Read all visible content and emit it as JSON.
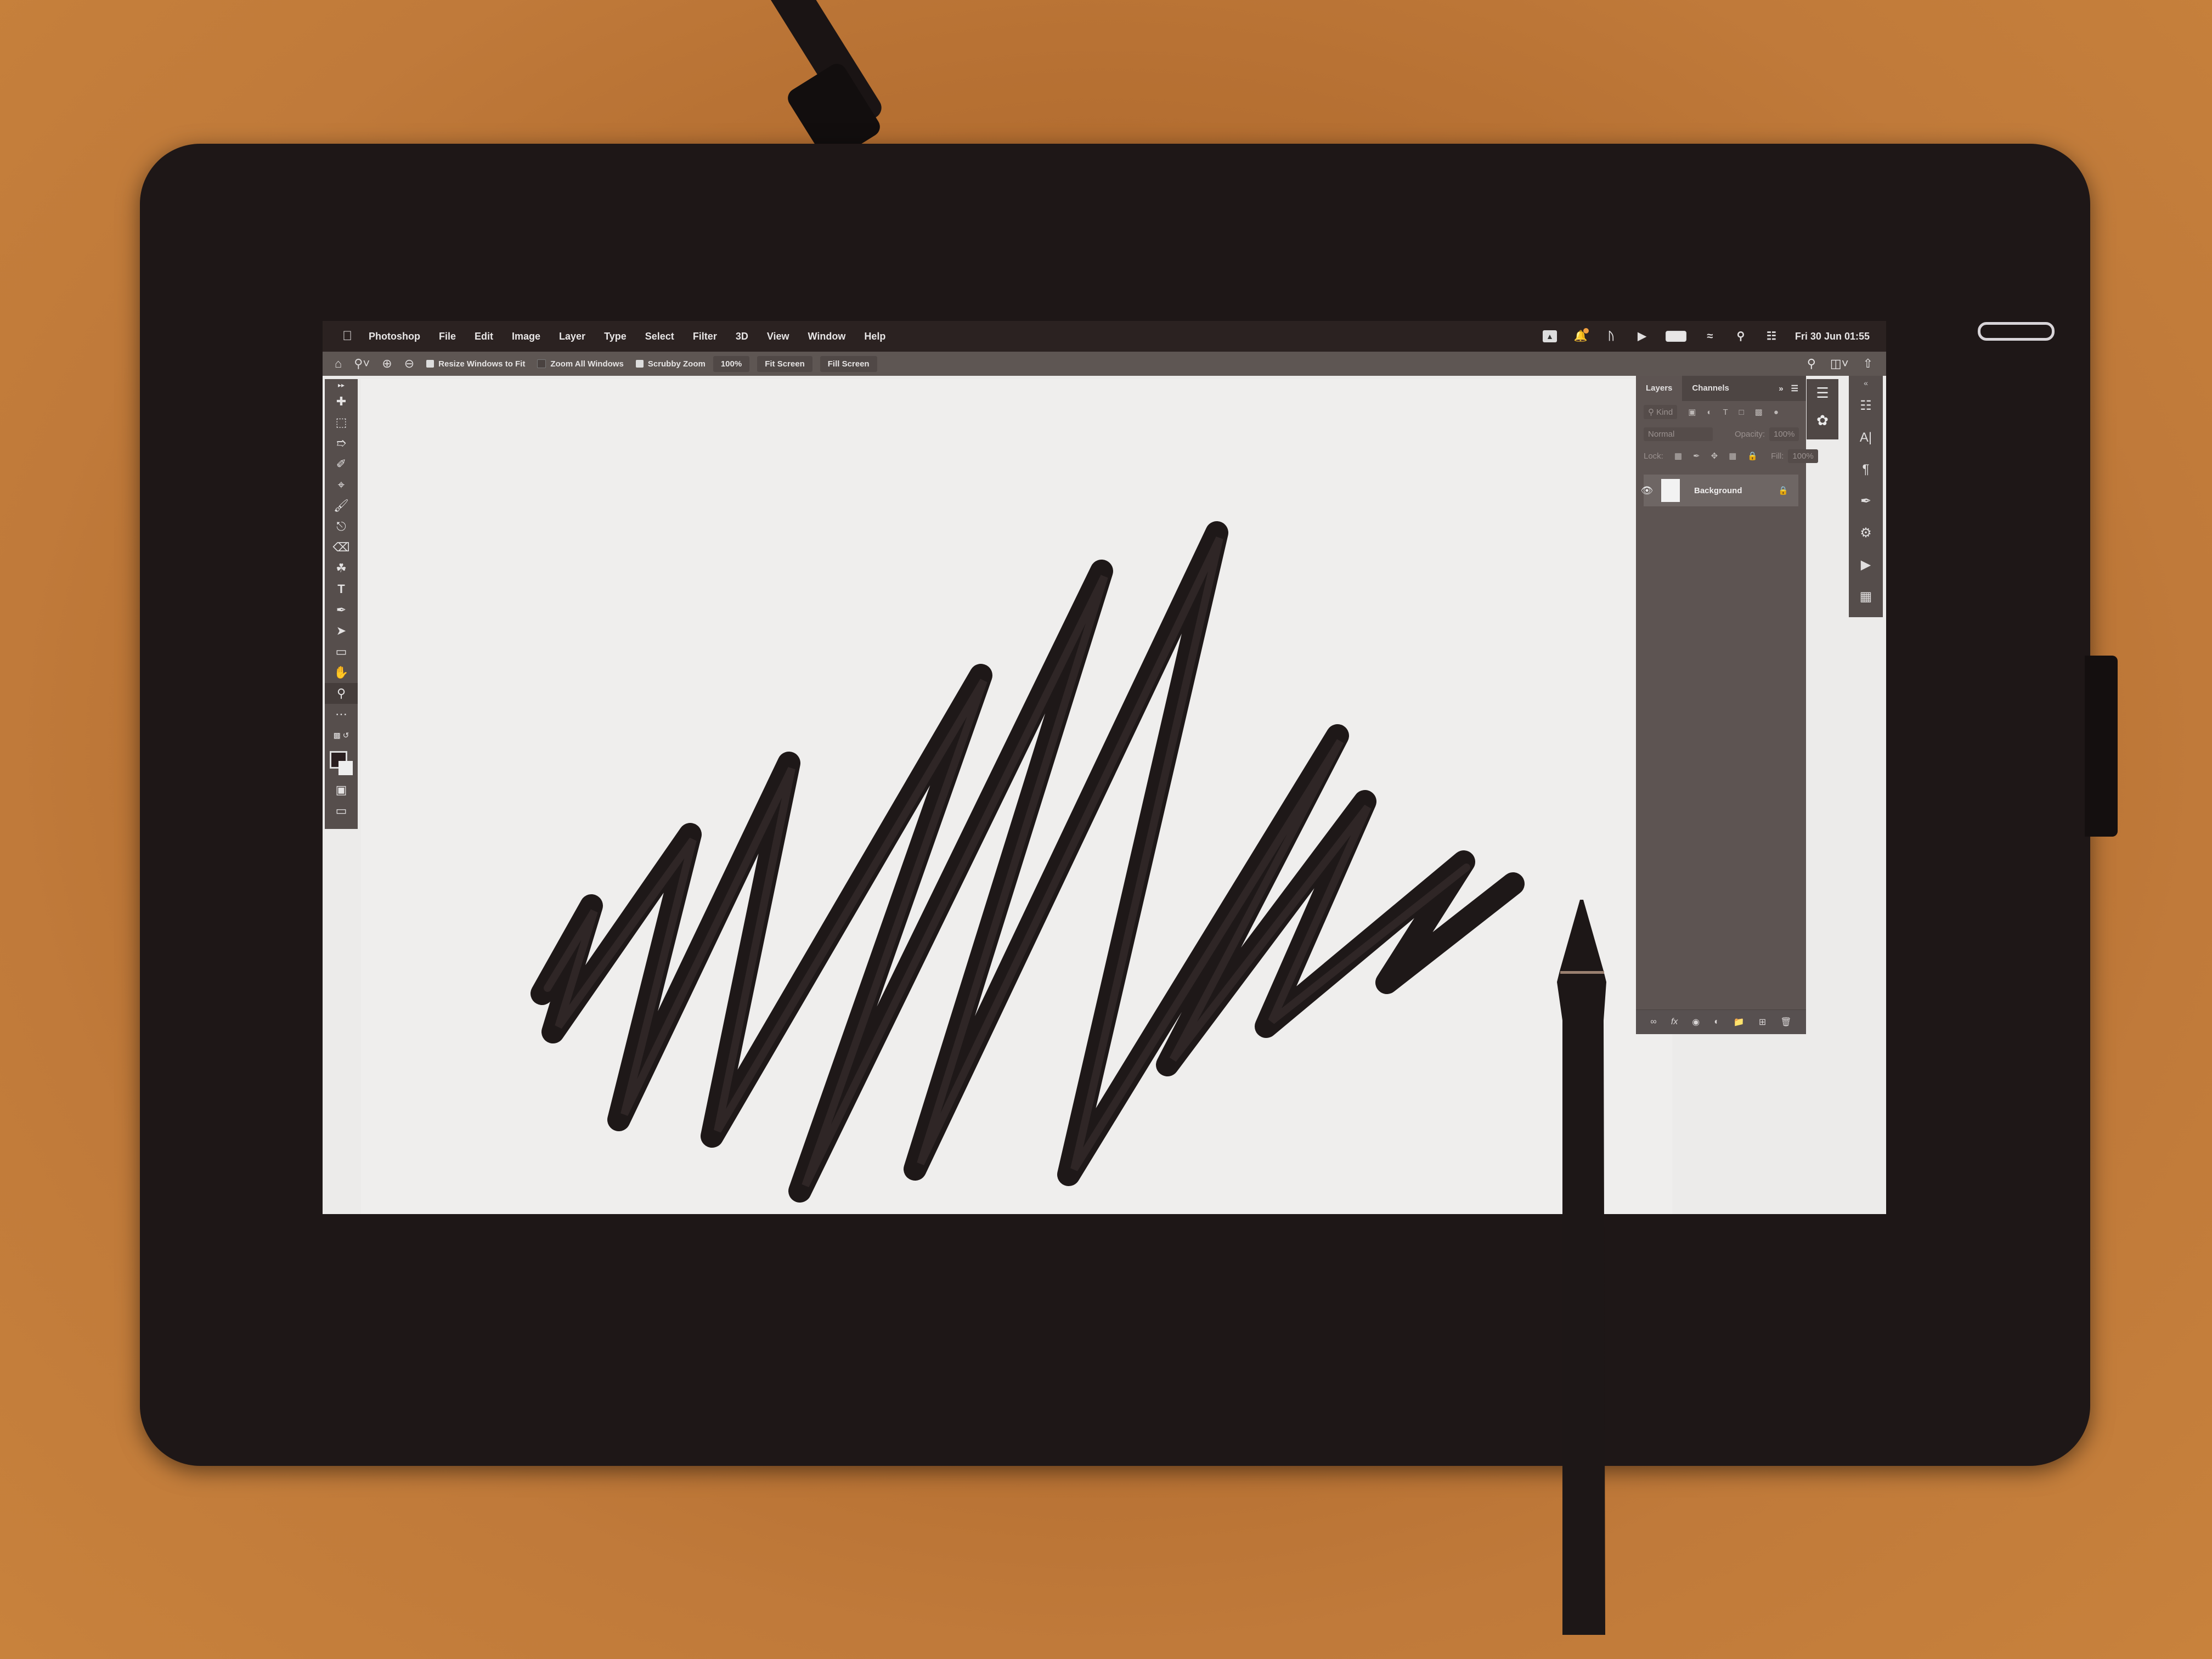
{
  "menubar": {
    "apple_icon": "apple-logo",
    "app_name": "Photoshop",
    "items": [
      "File",
      "Edit",
      "Image",
      "Layer",
      "Type",
      "Select",
      "Filter",
      "3D",
      "View",
      "Window",
      "Help"
    ],
    "status_icons": [
      "drive-icon",
      "notification-icon",
      "bluetooth-icon",
      "play-icon",
      "battery-icon",
      "wifi-icon",
      "spotlight-icon",
      "control-center-icon"
    ],
    "clock": "Fri 30 Jun  01:55"
  },
  "options_bar": {
    "tool_icon": "zoom-tool",
    "resize_windows_label": "Resize Windows to Fit",
    "resize_windows_checked": true,
    "zoom_all_label": "Zoom All Windows",
    "zoom_all_checked": false,
    "scrubby_label": "Scrubby Zoom",
    "scrubby_checked": true,
    "zoom_100": "100%",
    "fit_screen": "Fit Screen",
    "fill_screen": "Fill Screen"
  },
  "toolbar": {
    "tools": [
      "move",
      "marquee",
      "lasso",
      "quick-select",
      "crop",
      "eyedropper",
      "healing-brush",
      "brush",
      "clone-stamp",
      "eraser",
      "paint-bucket",
      "type",
      "pen",
      "path-select",
      "rectangle",
      "hand",
      "zoom",
      "more"
    ],
    "active_tool": "zoom"
  },
  "layers_panel": {
    "tabs": [
      "Layers",
      "Channels"
    ],
    "active_tab": "Layers",
    "filter_placeholder": "Kind",
    "blend_mode": "Normal",
    "opacity_label": "Opacity:",
    "opacity_value": "100%",
    "lock_label": "Lock:",
    "fill_label": "Fill:",
    "fill_value": "100%",
    "layers": [
      {
        "name": "Background",
        "visible": true,
        "locked": true
      }
    ],
    "footer_icons": [
      "link-layers",
      "fx",
      "add-mask",
      "adjustment",
      "new-group",
      "new-layer",
      "delete"
    ]
  },
  "right_dock": {
    "icons": [
      "properties",
      "character",
      "paragraph",
      "brush-settings",
      "adjustments",
      "actions",
      "swatches"
    ]
  },
  "colors": {
    "foreground": "#2a1f20",
    "background": "#eeeeee",
    "stroke": "#1e1818"
  }
}
